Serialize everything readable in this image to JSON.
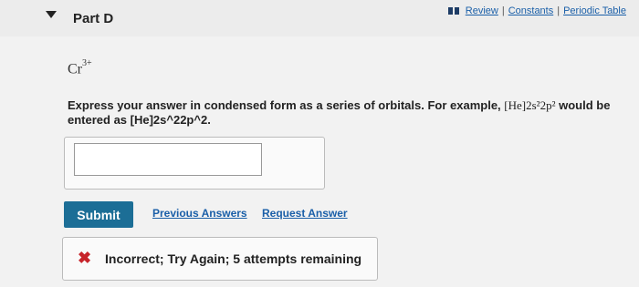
{
  "header": {
    "part_title": "Part D",
    "links": {
      "review": "Review",
      "constants": "Constants",
      "periodic_table": "Periodic Table",
      "separator": "|"
    }
  },
  "question": {
    "ion_base": "Cr",
    "ion_charge": "3+",
    "instruction_prefix": "Express your answer in condensed form as a series of orbitals. For example,",
    "example_notation": "[He]2s²2p²",
    "instruction_suffix": "would be entered as [He]2s^22p^2."
  },
  "answer": {
    "value": ""
  },
  "actions": {
    "submit": "Submit",
    "previous_answers": "Previous Answers",
    "request_answer": "Request Answer"
  },
  "feedback": {
    "message": "Incorrect; Try Again; 5 attempts remaining"
  },
  "colors": {
    "submit_bg": "#1c6e96",
    "link": "#1a5fa8",
    "error_icon": "#c7242b"
  }
}
